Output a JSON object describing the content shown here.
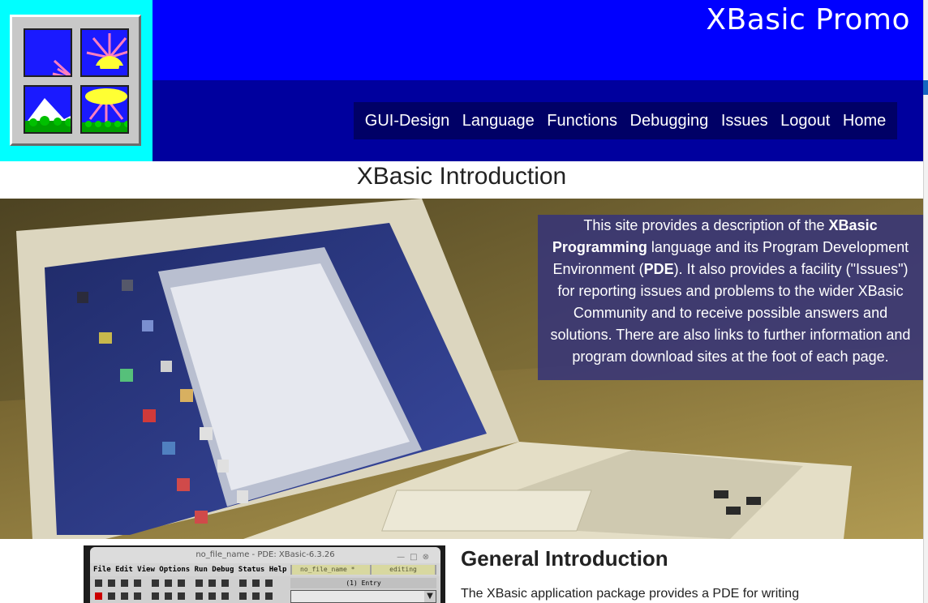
{
  "header": {
    "site_title": "XBasic Promo",
    "logo": {
      "name": "xbasic-logo"
    }
  },
  "nav": {
    "items": [
      {
        "label": "GUI-Design"
      },
      {
        "label": "Language"
      },
      {
        "label": "Functions"
      },
      {
        "label": "Debugging"
      },
      {
        "label": "Issues"
      },
      {
        "label": "Logout"
      },
      {
        "label": "Home"
      }
    ]
  },
  "page": {
    "heading": "XBasic Introduction"
  },
  "hero": {
    "intro_parts": [
      "This site provides a description of the ",
      "XBasic Programming",
      " language and its Program Development Environment (",
      "PDE",
      "). It also provides a facility (\"Issues\") for reporting issues and problems to the wider XBasic Community and to receive possible answers and solutions. There are also links to further information and program download sites at the foot of each page."
    ]
  },
  "section": {
    "heading": "General Introduction",
    "text": "The XBasic application package provides a PDE for writing"
  },
  "pde_screenshot": {
    "title": "no_file_name - PDE: XBasic-6.3.26",
    "menu": "File Edit View Options Run Debug Status Help",
    "file_label": "no_file_name *",
    "mode_label": "editing",
    "entry_label": "(1) Entry"
  },
  "colors": {
    "logo_bg": "#00ffff",
    "header_top": "#0000ff",
    "header_bottom": "#00009e",
    "nav_bg": "#000066"
  }
}
